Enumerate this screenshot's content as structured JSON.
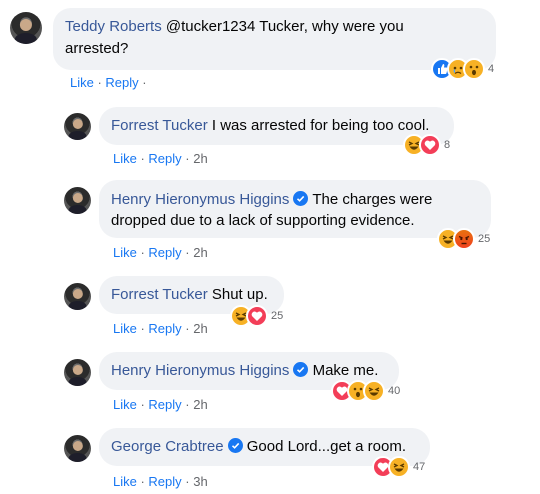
{
  "comments": [
    {
      "author": "Teddy Roberts",
      "text": "@tucker1234 Tucker, why were you arrested?",
      "line1": "@tucker1234 Tucker, why were you",
      "line2": "arrested?",
      "verified": false,
      "like_label": "Like",
      "reply_label": "Reply",
      "time": "",
      "reactions": [
        "like-icon",
        "sad-icon",
        "wow-icon"
      ],
      "reaction_count": "4"
    },
    {
      "author": "Forrest Tucker",
      "text": "I was arrested for being too cool.",
      "verified": false,
      "like_label": "Like",
      "reply_label": "Reply",
      "time": "2h",
      "reactions": [
        "haha-icon",
        "love-icon"
      ],
      "reaction_count": "8"
    },
    {
      "author": "Henry Hieronymus Higgins",
      "line1": "The charges were",
      "line2": "dropped due to a lack of supporting evidence.",
      "verified": true,
      "like_label": "Like",
      "reply_label": "Reply",
      "time": "2h",
      "reactions": [
        "haha-icon",
        "angry-icon"
      ],
      "reaction_count": "25"
    },
    {
      "author": "Forrest Tucker",
      "text": "Shut up.",
      "verified": false,
      "like_label": "Like",
      "reply_label": "Reply",
      "time": "2h",
      "reactions": [
        "haha-icon",
        "love-icon"
      ],
      "reaction_count": "25"
    },
    {
      "author": "Henry Hieronymus Higgins",
      "text": "Make me.",
      "verified": true,
      "like_label": "Like",
      "reply_label": "Reply",
      "time": "2h",
      "reactions": [
        "love-icon",
        "wow-icon",
        "haha-icon"
      ],
      "reaction_count": "40"
    },
    {
      "author": "George Crabtree",
      "text": "Good Lord...get a room.",
      "verified": true,
      "like_label": "Like",
      "reply_label": "Reply",
      "time": "3h",
      "reactions": [
        "love-icon",
        "haha-icon"
      ],
      "reaction_count": "47"
    }
  ],
  "colors": {
    "link": "#385898",
    "action": "#1877f2",
    "muted": "#65676b",
    "bubble": "#f0f2f5"
  }
}
